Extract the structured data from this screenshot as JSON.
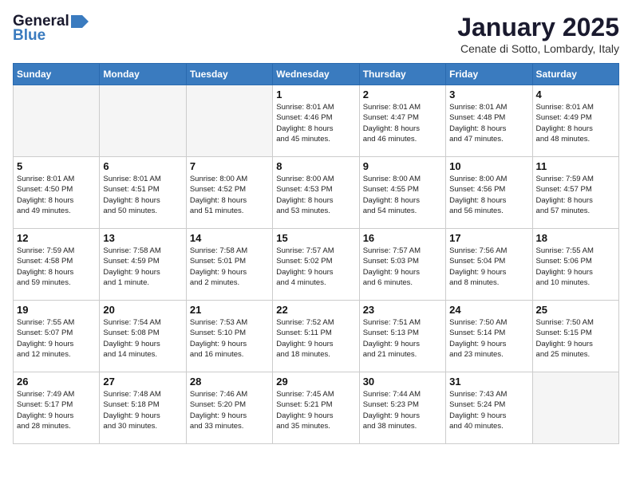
{
  "header": {
    "logo_general": "General",
    "logo_blue": "Blue",
    "title": "January 2025",
    "location": "Cenate di Sotto, Lombardy, Italy"
  },
  "weekdays": [
    "Sunday",
    "Monday",
    "Tuesday",
    "Wednesday",
    "Thursday",
    "Friday",
    "Saturday"
  ],
  "weeks": [
    [
      {
        "day": "",
        "info": ""
      },
      {
        "day": "",
        "info": ""
      },
      {
        "day": "",
        "info": ""
      },
      {
        "day": "1",
        "info": "Sunrise: 8:01 AM\nSunset: 4:46 PM\nDaylight: 8 hours\nand 45 minutes."
      },
      {
        "day": "2",
        "info": "Sunrise: 8:01 AM\nSunset: 4:47 PM\nDaylight: 8 hours\nand 46 minutes."
      },
      {
        "day": "3",
        "info": "Sunrise: 8:01 AM\nSunset: 4:48 PM\nDaylight: 8 hours\nand 47 minutes."
      },
      {
        "day": "4",
        "info": "Sunrise: 8:01 AM\nSunset: 4:49 PM\nDaylight: 8 hours\nand 48 minutes."
      }
    ],
    [
      {
        "day": "5",
        "info": "Sunrise: 8:01 AM\nSunset: 4:50 PM\nDaylight: 8 hours\nand 49 minutes."
      },
      {
        "day": "6",
        "info": "Sunrise: 8:01 AM\nSunset: 4:51 PM\nDaylight: 8 hours\nand 50 minutes."
      },
      {
        "day": "7",
        "info": "Sunrise: 8:00 AM\nSunset: 4:52 PM\nDaylight: 8 hours\nand 51 minutes."
      },
      {
        "day": "8",
        "info": "Sunrise: 8:00 AM\nSunset: 4:53 PM\nDaylight: 8 hours\nand 53 minutes."
      },
      {
        "day": "9",
        "info": "Sunrise: 8:00 AM\nSunset: 4:55 PM\nDaylight: 8 hours\nand 54 minutes."
      },
      {
        "day": "10",
        "info": "Sunrise: 8:00 AM\nSunset: 4:56 PM\nDaylight: 8 hours\nand 56 minutes."
      },
      {
        "day": "11",
        "info": "Sunrise: 7:59 AM\nSunset: 4:57 PM\nDaylight: 8 hours\nand 57 minutes."
      }
    ],
    [
      {
        "day": "12",
        "info": "Sunrise: 7:59 AM\nSunset: 4:58 PM\nDaylight: 8 hours\nand 59 minutes."
      },
      {
        "day": "13",
        "info": "Sunrise: 7:58 AM\nSunset: 4:59 PM\nDaylight: 9 hours\nand 1 minute."
      },
      {
        "day": "14",
        "info": "Sunrise: 7:58 AM\nSunset: 5:01 PM\nDaylight: 9 hours\nand 2 minutes."
      },
      {
        "day": "15",
        "info": "Sunrise: 7:57 AM\nSunset: 5:02 PM\nDaylight: 9 hours\nand 4 minutes."
      },
      {
        "day": "16",
        "info": "Sunrise: 7:57 AM\nSunset: 5:03 PM\nDaylight: 9 hours\nand 6 minutes."
      },
      {
        "day": "17",
        "info": "Sunrise: 7:56 AM\nSunset: 5:04 PM\nDaylight: 9 hours\nand 8 minutes."
      },
      {
        "day": "18",
        "info": "Sunrise: 7:55 AM\nSunset: 5:06 PM\nDaylight: 9 hours\nand 10 minutes."
      }
    ],
    [
      {
        "day": "19",
        "info": "Sunrise: 7:55 AM\nSunset: 5:07 PM\nDaylight: 9 hours\nand 12 minutes."
      },
      {
        "day": "20",
        "info": "Sunrise: 7:54 AM\nSunset: 5:08 PM\nDaylight: 9 hours\nand 14 minutes."
      },
      {
        "day": "21",
        "info": "Sunrise: 7:53 AM\nSunset: 5:10 PM\nDaylight: 9 hours\nand 16 minutes."
      },
      {
        "day": "22",
        "info": "Sunrise: 7:52 AM\nSunset: 5:11 PM\nDaylight: 9 hours\nand 18 minutes."
      },
      {
        "day": "23",
        "info": "Sunrise: 7:51 AM\nSunset: 5:13 PM\nDaylight: 9 hours\nand 21 minutes."
      },
      {
        "day": "24",
        "info": "Sunrise: 7:50 AM\nSunset: 5:14 PM\nDaylight: 9 hours\nand 23 minutes."
      },
      {
        "day": "25",
        "info": "Sunrise: 7:50 AM\nSunset: 5:15 PM\nDaylight: 9 hours\nand 25 minutes."
      }
    ],
    [
      {
        "day": "26",
        "info": "Sunrise: 7:49 AM\nSunset: 5:17 PM\nDaylight: 9 hours\nand 28 minutes."
      },
      {
        "day": "27",
        "info": "Sunrise: 7:48 AM\nSunset: 5:18 PM\nDaylight: 9 hours\nand 30 minutes."
      },
      {
        "day": "28",
        "info": "Sunrise: 7:46 AM\nSunset: 5:20 PM\nDaylight: 9 hours\nand 33 minutes."
      },
      {
        "day": "29",
        "info": "Sunrise: 7:45 AM\nSunset: 5:21 PM\nDaylight: 9 hours\nand 35 minutes."
      },
      {
        "day": "30",
        "info": "Sunrise: 7:44 AM\nSunset: 5:23 PM\nDaylight: 9 hours\nand 38 minutes."
      },
      {
        "day": "31",
        "info": "Sunrise: 7:43 AM\nSunset: 5:24 PM\nDaylight: 9 hours\nand 40 minutes."
      },
      {
        "day": "",
        "info": ""
      }
    ]
  ]
}
